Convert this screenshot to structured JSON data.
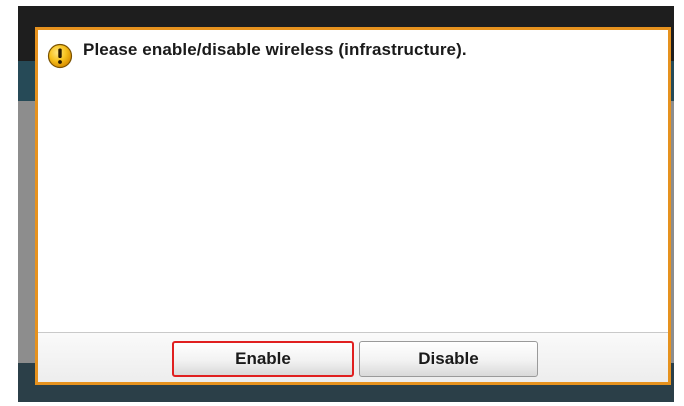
{
  "dialog": {
    "message": "Please enable/disable wireless (infrastructure).",
    "icon": "warning-icon",
    "border_color": "#e6921e"
  },
  "buttons": {
    "enable_label": "Enable",
    "disable_label": "Disable",
    "highlight_color": "#e02020"
  }
}
